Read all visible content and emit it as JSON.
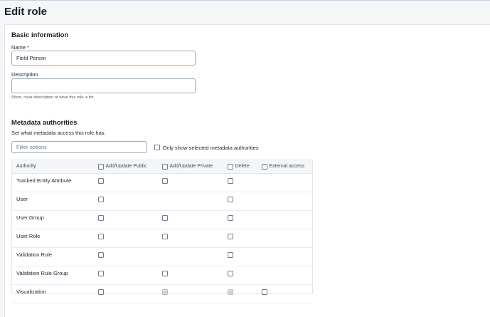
{
  "page": {
    "title": "Edit role"
  },
  "basic": {
    "section_title": "Basic information",
    "name_label": "Name *",
    "name_value": "Field Person",
    "description_label": "Description",
    "description_value": "",
    "description_help": "Short, clear description of what this role is for."
  },
  "metadata": {
    "section_title": "Metadata authorities",
    "description": "Set what metadata access this role has.",
    "filter_placeholder": "Filter options",
    "only_selected_label": "Only show selected metadata authorities",
    "columns": {
      "authority": "Authority",
      "add_update_public": "Add/Update Public",
      "add_update_private": "Add/Update Private",
      "delete": "Delete",
      "external_access": "External access"
    },
    "rows": [
      {
        "name": "Tracked Entity Attribute",
        "pub": "unchecked",
        "priv": "unchecked",
        "del": "unchecked",
        "ext": "none"
      },
      {
        "name": "User",
        "pub": "unchecked",
        "priv": "none",
        "del": "unchecked",
        "ext": "none"
      },
      {
        "name": "User Group",
        "pub": "unchecked",
        "priv": "unchecked",
        "del": "unchecked",
        "ext": "none"
      },
      {
        "name": "User Role",
        "pub": "unchecked",
        "priv": "unchecked",
        "del": "unchecked",
        "ext": "none"
      },
      {
        "name": "Validation Rule",
        "pub": "unchecked",
        "priv": "none",
        "del": "unchecked",
        "ext": "none"
      },
      {
        "name": "Validation Rule Group",
        "pub": "unchecked",
        "priv": "unchecked",
        "del": "unchecked",
        "ext": "none"
      },
      {
        "name": "Visualization",
        "pub": "unchecked",
        "priv": "checked-disabled",
        "del": "checked-disabled",
        "ext": "unchecked"
      }
    ]
  }
}
